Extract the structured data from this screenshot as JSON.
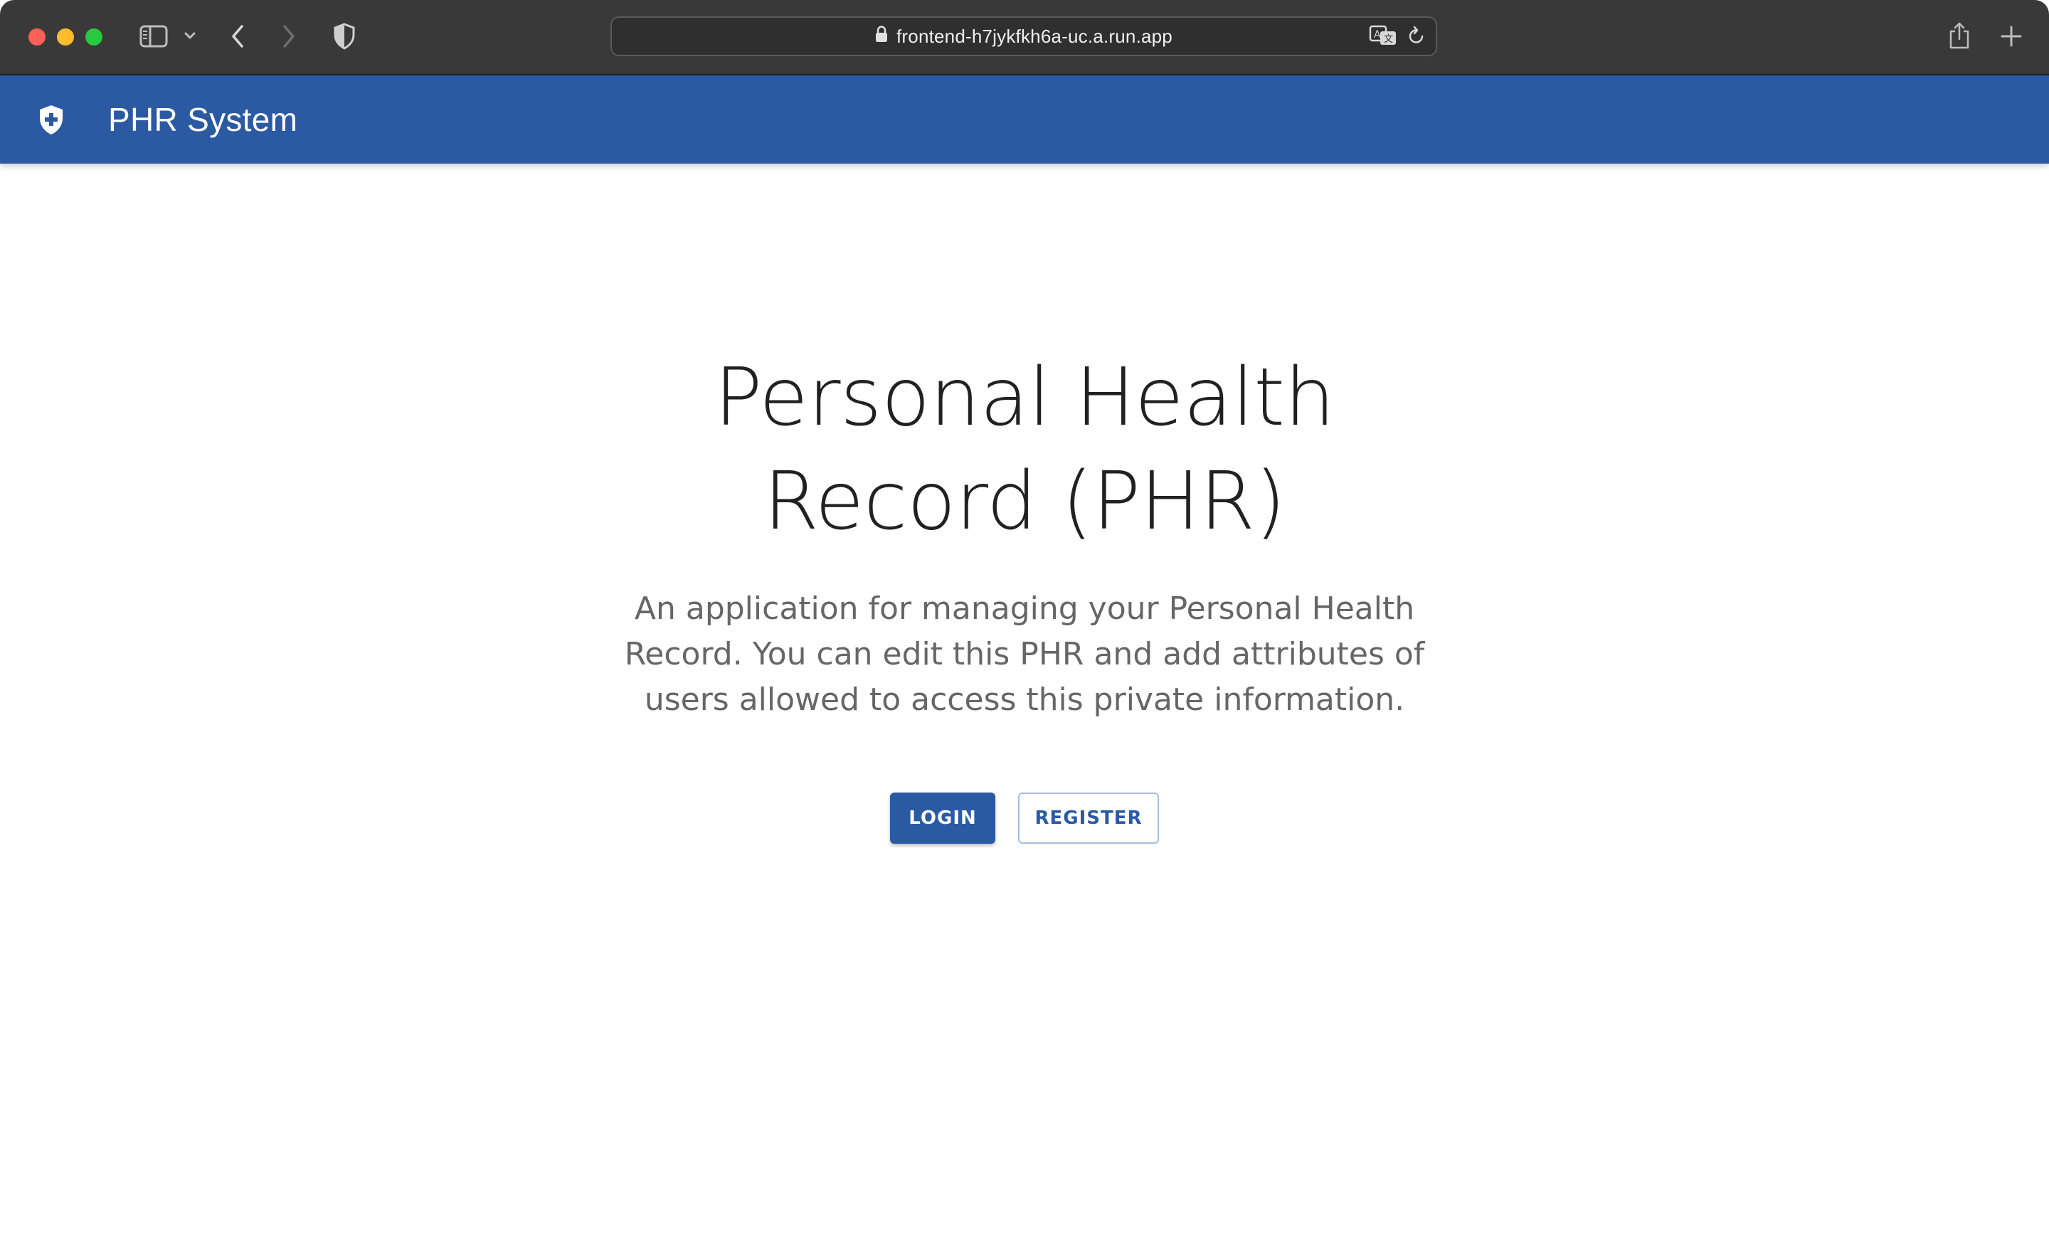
{
  "browser": {
    "url": "frontend-h7jykfkh6a-uc.a.run.app",
    "icons": {
      "sidebar": "sidebar-icon",
      "sidebar_menu": "chevron-down-icon",
      "back": "back-icon",
      "forward": "forward-icon",
      "privacy": "shield-icon",
      "lock": "lock-icon",
      "translate": "translate-icon",
      "reload": "reload-icon",
      "share": "share-icon",
      "new_tab": "plus-icon"
    }
  },
  "appbar": {
    "title": "PHR System",
    "logo_icon": "shield-plus-icon",
    "color": "#2b5aa3"
  },
  "hero": {
    "title": "Personal Health Record (PHR)",
    "description": "An application for managing your Personal Health Record. You can edit this PHR and add attributes of users allowed to access this private information."
  },
  "actions": {
    "login_label": "LOGIN",
    "register_label": "REGISTER"
  }
}
